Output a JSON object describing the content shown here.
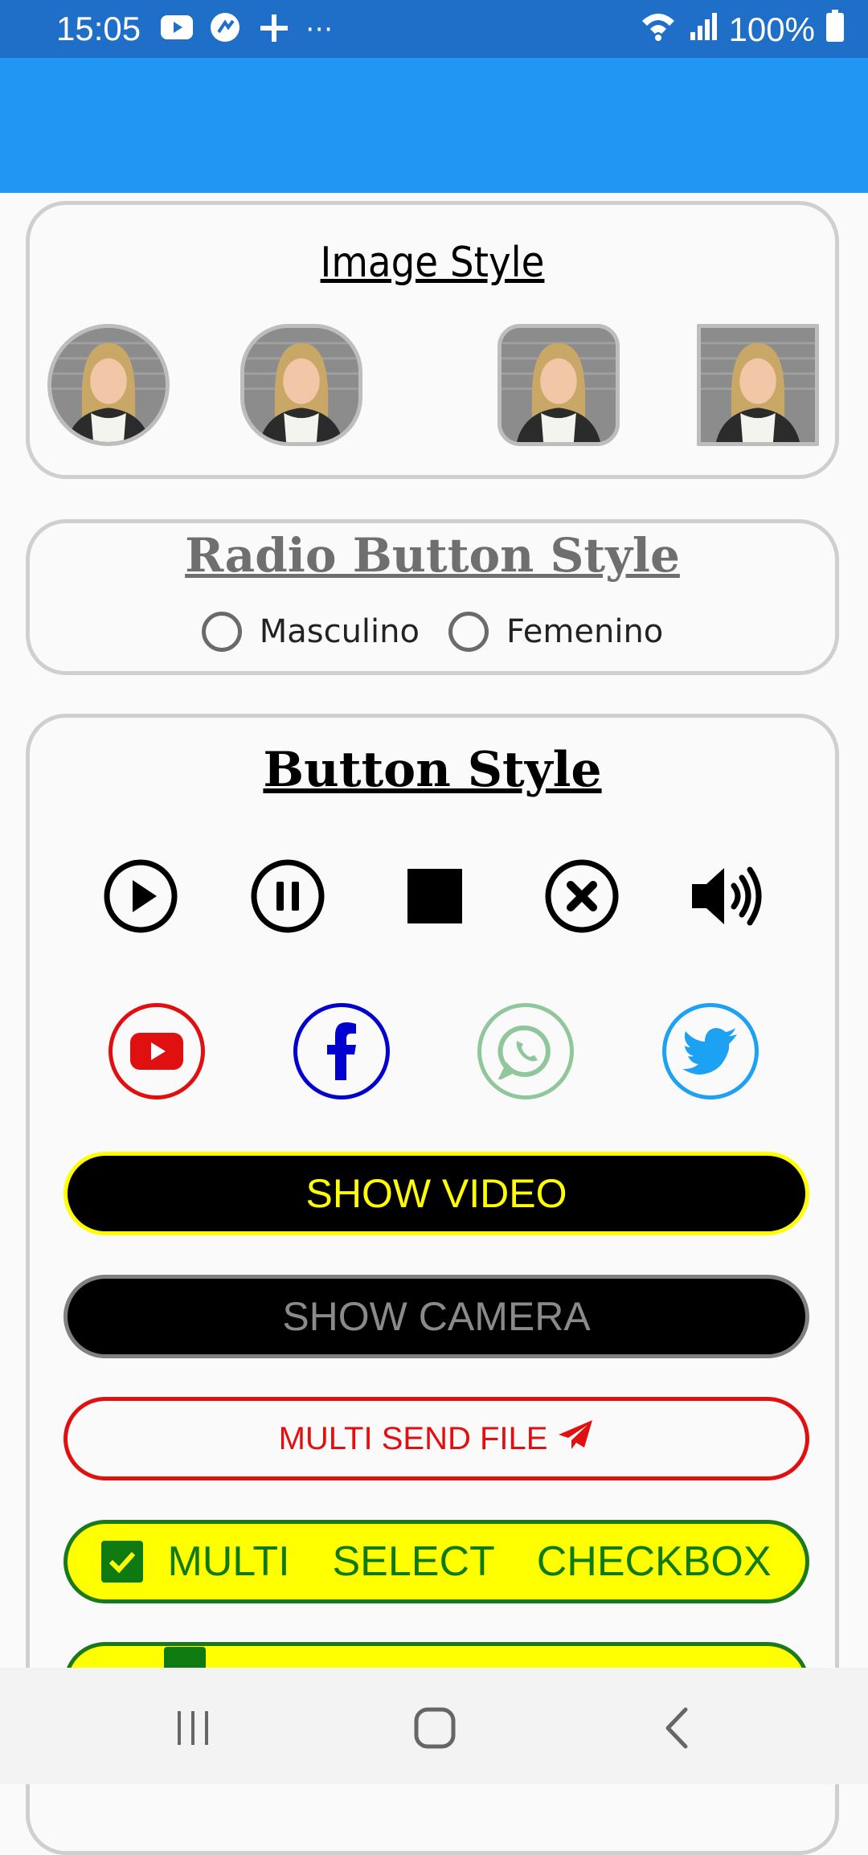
{
  "status_bar": {
    "time": "15:05",
    "battery": "100%",
    "more": "⋯",
    "icons": [
      "youtube-icon",
      "speed-icon",
      "plus-icon",
      "wifi-icon",
      "signal-icon",
      "battery-icon"
    ]
  },
  "image_section": {
    "title": "Image Style",
    "avatars": [
      "circle",
      "rounded-large",
      "rounded-small",
      "square"
    ]
  },
  "radio_section": {
    "title": "Radio Button Style",
    "options": [
      {
        "label": "Masculino",
        "checked": false
      },
      {
        "label": "Femenino",
        "checked": false
      }
    ]
  },
  "button_section": {
    "title": "Button Style",
    "controls": [
      "play-icon",
      "pause-icon",
      "stop-icon",
      "close-icon",
      "volume-icon"
    ],
    "socials": [
      {
        "name": "youtube-icon",
        "color": "#e01010"
      },
      {
        "name": "facebook-icon",
        "color": "#0000d0"
      },
      {
        "name": "whatsapp-icon",
        "color": "#8fc79a"
      },
      {
        "name": "twitter-icon",
        "color": "#1da1f2"
      }
    ],
    "show_video": "SHOW VIDEO",
    "show_camera": "SHOW CAMERA",
    "multi_send": "MULTI SEND FILE",
    "multi_select": "MULTI  SELECT  CHECKBOX"
  },
  "colors": {
    "status_bar": "#1f6fc9",
    "app_bar": "#2196f3",
    "yellow": "#ffff00",
    "green": "#0f7a0f",
    "red": "#e01010"
  }
}
